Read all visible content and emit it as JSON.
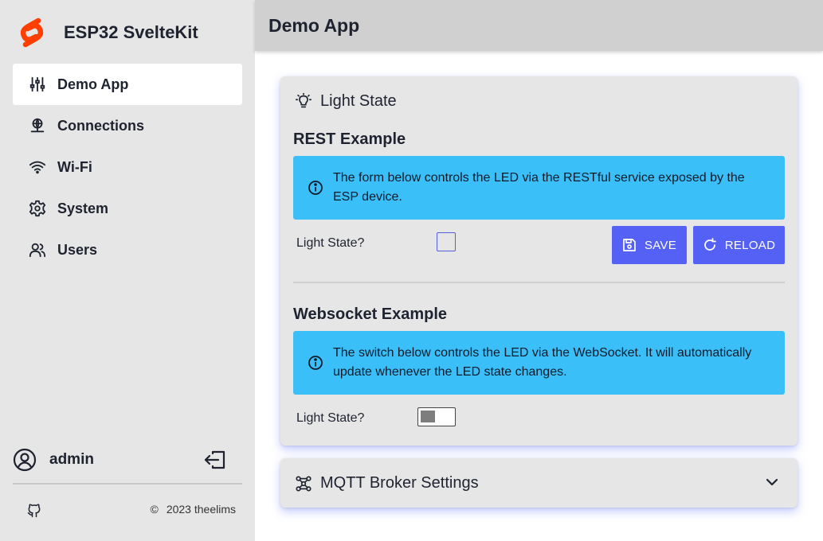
{
  "app": {
    "title": "ESP32 SvelteKit",
    "logo": "svelte-logo",
    "accent": "#ff3e00"
  },
  "sidebar": {
    "items": [
      {
        "label": "Demo App",
        "icon": "sliders-icon",
        "active": true
      },
      {
        "label": "Connections",
        "icon": "network-icon",
        "active": false
      },
      {
        "label": "Wi-Fi",
        "icon": "wifi-icon",
        "active": false
      },
      {
        "label": "System",
        "icon": "gear-icon",
        "active": false
      },
      {
        "label": "Users",
        "icon": "users-icon",
        "active": false
      }
    ],
    "user": {
      "name": "admin"
    },
    "footer": {
      "copyright": "2023 theelims"
    }
  },
  "header": {
    "title": "Demo App"
  },
  "light_card": {
    "title": "Light State",
    "rest": {
      "title": "REST Example",
      "info": "The form below controls the LED via the RESTful service exposed by the ESP device.",
      "field_label": "Light State?",
      "checked": false,
      "save_label": "SAVE",
      "reload_label": "RELOAD"
    },
    "websocket": {
      "title": "Websocket Example",
      "info": "The switch below controls the LED via the WebSocket. It will automatically update whenever the LED state changes.",
      "field_label": "Light State?",
      "on": false
    }
  },
  "mqtt_card": {
    "title": "MQTT Broker Settings",
    "expanded": false
  },
  "colors": {
    "button": "#5561f5",
    "info": "#3abff8",
    "sidebar": "#e6e6e6",
    "header": "#d0d0d0"
  }
}
